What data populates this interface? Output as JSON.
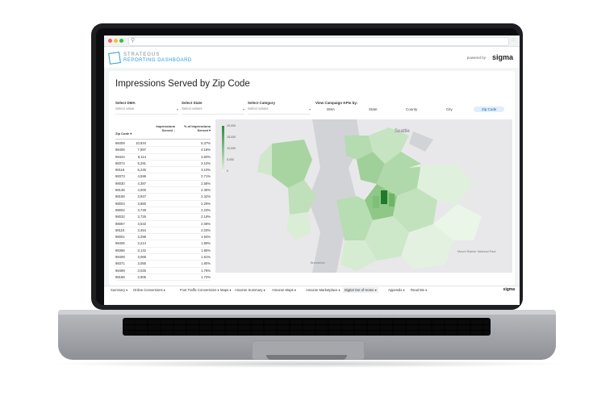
{
  "brand": {
    "line1": "STRATEGUS",
    "line2": "REPORTING DASHBOARD",
    "powered_by": "powered by",
    "sigma": "sigma"
  },
  "page": {
    "title": "Impressions Served by Zip Code"
  },
  "filters": [
    {
      "label": "Select DMA",
      "placeholder": "Select value"
    },
    {
      "label": "Select State",
      "placeholder": "Select values"
    },
    {
      "label": "Select Category",
      "placeholder": "Select values"
    }
  ],
  "kpi": {
    "label": "View Campaign KPIs by:",
    "options": [
      "DMA",
      "State",
      "County",
      "City",
      "Zip Code"
    ],
    "active": "Zip Code"
  },
  "table": {
    "headers": {
      "zip": "Zip Code",
      "impressions": "Impressions Served",
      "pct": "% of Impressions Served"
    },
    "rows": [
      [
        "98409",
        "10,934",
        "5.37%"
      ],
      [
        "98406",
        "7,997",
        "4.18%"
      ],
      [
        "98424",
        "6,114",
        "3.60%"
      ],
      [
        "98374",
        "5,291",
        "3.10%"
      ],
      [
        "98118",
        "5,245",
        "3.10%"
      ],
      [
        "98373",
        "4,596",
        "2.71%"
      ],
      [
        "98030",
        "4,387",
        "2.58%"
      ],
      [
        "98136",
        "4,000",
        "2.36%"
      ],
      [
        "98188",
        "3,947",
        "2.32%"
      ],
      [
        "98003",
        "3,880",
        "2.29%"
      ],
      [
        "98002",
        "3,749",
        "2.23%"
      ],
      [
        "98032",
        "3,726",
        "2.19%"
      ],
      [
        "98057",
        "3,532",
        "2.08%"
      ],
      [
        "98115",
        "3,454",
        "2.03%"
      ],
      [
        "98001",
        "3,296",
        "1.94%"
      ],
      [
        "98406",
        "3,214",
        "1.89%"
      ],
      [
        "98366",
        "3,142",
        "1.85%"
      ],
      [
        "98408",
        "3,068",
        "1.81%"
      ],
      [
        "98371",
        "3,055",
        "1.80%"
      ],
      [
        "98499",
        "3,025",
        "1.78%"
      ],
      [
        "98188",
        "2,905",
        "1.72%"
      ]
    ]
  },
  "legend": {
    "ticks": [
      "20,000",
      "15,000",
      "10,000",
      "5,000",
      "0"
    ]
  },
  "map": {
    "cities": [
      "Seattle",
      "Bremerton",
      "Mount Rainier National Park"
    ]
  },
  "tabs": [
    "Summary",
    "Online Conversions",
    "Foot Traffic Conversions",
    "Maps",
    "Amazon Summary",
    "Amazon Maps",
    "Amazon Marketplace",
    "Digital Out of Home",
    "Appendix",
    "Read Me"
  ],
  "active_tab": "Digital Out of Home",
  "colors": {
    "accent": "#2a9fd6",
    "map_dark": "#2e8a3a",
    "map_light": "#e9f5e8"
  }
}
